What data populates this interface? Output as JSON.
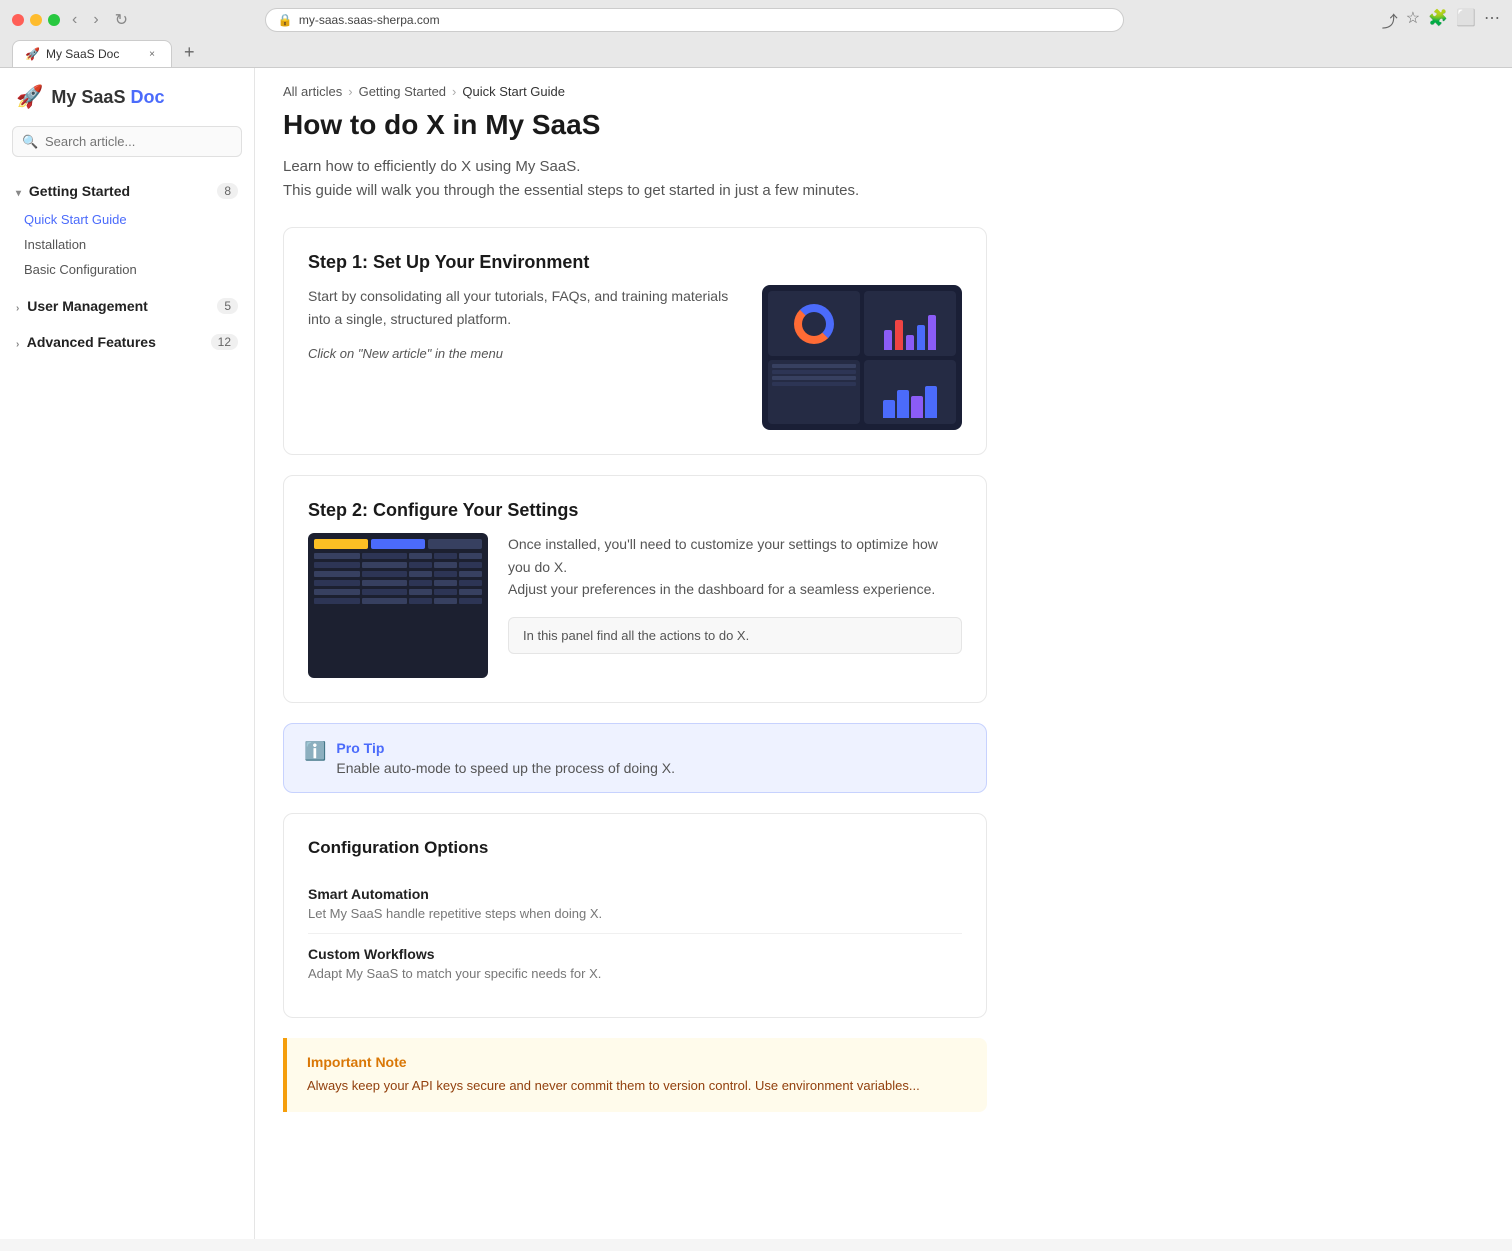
{
  "browser": {
    "url": "my-saas.saas-sherpa.com",
    "tab_title": "My SaaS Doc",
    "tab_close": "×",
    "new_tab": "+"
  },
  "logo": {
    "icon": "🚀",
    "text_normal": "My SaaS",
    "text_accent": " Doc"
  },
  "sidebar": {
    "search_placeholder": "Search article...",
    "sections": [
      {
        "label": "Getting Started",
        "badge": "8",
        "expanded": true,
        "items": [
          {
            "label": "Quick Start Guide",
            "active": true
          },
          {
            "label": "Installation",
            "active": false
          },
          {
            "label": "Basic Configuration",
            "active": false
          }
        ]
      },
      {
        "label": "User Management",
        "badge": "5",
        "expanded": false,
        "items": []
      },
      {
        "label": "Advanced Features",
        "badge": "12",
        "expanded": false,
        "items": []
      }
    ]
  },
  "breadcrumb": {
    "items": [
      "All articles",
      "Getting Started",
      "Quick Start Guide"
    ]
  },
  "article": {
    "title": "How to do X in My SaaS",
    "intro_line1": "Learn how to efficiently do X using My SaaS.",
    "intro_line2": "This guide will walk you through the essential steps to get started in just a few minutes.",
    "step1": {
      "title": "Step 1: Set Up Your Environment",
      "desc": "Start by consolidating all your tutorials, FAQs, and training materials into a single, structured platform.",
      "action": "Click on \"New article\" in the menu"
    },
    "step2": {
      "title": "Step 2: Configure Your Settings",
      "desc_line1": "Once installed, you'll need to customize your settings to optimize how you do X.",
      "desc_line2": "Adjust your preferences in the dashboard for a seamless experience.",
      "callout": "In this panel find all the actions to do X."
    },
    "pro_tip": {
      "label": "Pro Tip",
      "text": "Enable auto-mode to speed up the process of doing X."
    },
    "config": {
      "title": "Configuration Options",
      "items": [
        {
          "title": "Smart Automation",
          "desc": "Let My SaaS handle repetitive steps when doing X."
        },
        {
          "title": "Custom Workflows",
          "desc": "Adapt My SaaS to match your specific needs for X."
        }
      ]
    },
    "important": {
      "label": "Important Note",
      "text": "Always keep your API keys secure and never commit them to version control. Use environment variables..."
    }
  }
}
